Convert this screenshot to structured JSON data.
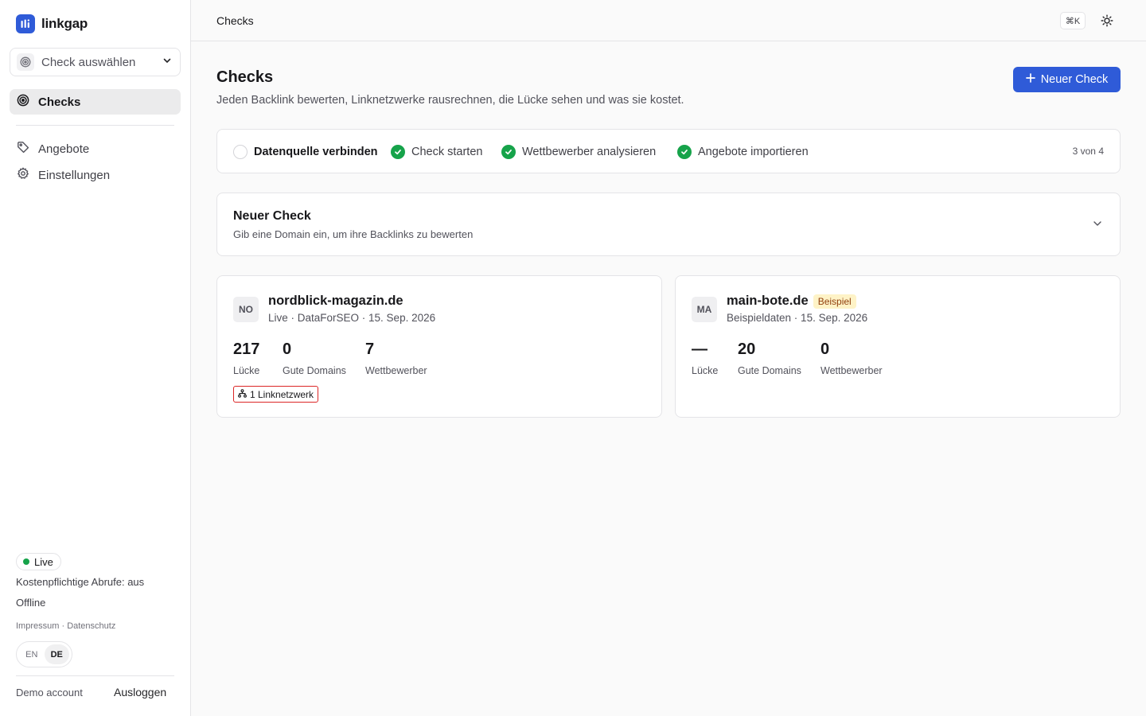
{
  "app": {
    "name": "linkgap"
  },
  "sidebar": {
    "check_select_label": "Check auswählen",
    "nav": [
      {
        "label": "Checks",
        "icon": "target-icon",
        "active": true
      },
      {
        "label": "Angebote",
        "icon": "tag-icon"
      },
      {
        "label": "Einstellungen",
        "icon": "gear-icon"
      }
    ],
    "status_pill": "Live",
    "paid_requests": "Kostenpflichtige Abrufe: aus",
    "connection": "Offline",
    "legal": {
      "imprint": "Impressum",
      "separator": " · ",
      "privacy": "Datenschutz"
    },
    "languages": [
      {
        "code": "EN"
      },
      {
        "code": "DE",
        "active": true
      }
    ],
    "account_label": "Demo account",
    "logout_label": "Ausloggen"
  },
  "header": {
    "breadcrumb": "Checks",
    "shortcut": "⌘K",
    "theme_icon": "sun-icon"
  },
  "main": {
    "title": "Checks",
    "subtitle": "Jeden Backlink bewerten, Linknetzwerke rausrechnen, die Lücke sehen und was sie kostet.",
    "new_check_button": "Neuer Check",
    "steps": [
      {
        "label": "Datenquelle verbinden",
        "done": false
      },
      {
        "label": "Check starten",
        "done": true
      },
      {
        "label": "Wettbewerber analysieren",
        "done": true
      },
      {
        "label": "Angebote importieren",
        "done": true
      }
    ],
    "steps_progress": "3 von 4",
    "new_check_panel": {
      "title": "Neuer Check",
      "subtitle": "Gib eine Domain ein, um ihre Backlinks zu bewerten"
    },
    "checks": [
      {
        "initials": "NO",
        "domain": "nordblick-magazin.de",
        "badge": "",
        "meta": "Live · DataForSEO · 15. Sep. 2026",
        "stats": [
          {
            "value": "217",
            "label": "Lücke"
          },
          {
            "value": "0",
            "label": "Gute Domains"
          },
          {
            "value": "7",
            "label": "Wettbewerber"
          }
        ],
        "network_badge": "1 Linknetzwerk"
      },
      {
        "initials": "MA",
        "domain": "main-bote.de",
        "badge": "Beispiel",
        "meta": "Beispieldaten · 15. Sep. 2026",
        "stats": [
          {
            "value": "—",
            "label": "Lücke"
          },
          {
            "value": "20",
            "label": "Gute Domains"
          },
          {
            "value": "0",
            "label": "Wettbewerber"
          }
        ],
        "network_badge": ""
      }
    ]
  },
  "colors": {
    "brand": "#2f5bd8",
    "success": "#16a34a",
    "danger": "#dc2626",
    "example_badge_bg": "#fef3c7",
    "example_badge_fg": "#92400e"
  }
}
